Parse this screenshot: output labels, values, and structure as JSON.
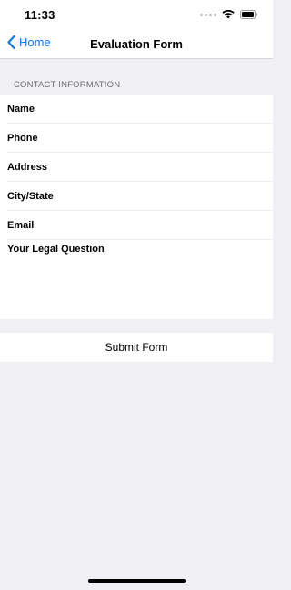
{
  "status_bar": {
    "time": "11:33"
  },
  "nav": {
    "back_label": "Home",
    "title": "Evaluation Form"
  },
  "section": {
    "header": "CONTACT INFORMATION"
  },
  "form": {
    "fields": [
      {
        "label": "Name"
      },
      {
        "label": "Phone"
      },
      {
        "label": "Address"
      },
      {
        "label": "City/State"
      },
      {
        "label": "Email"
      }
    ],
    "question_label": "Your Legal Question"
  },
  "submit": {
    "label": "Submit Form"
  },
  "colors": {
    "accent": "#0a7aff",
    "background": "#efeff4",
    "section_text": "#6d6d72"
  }
}
